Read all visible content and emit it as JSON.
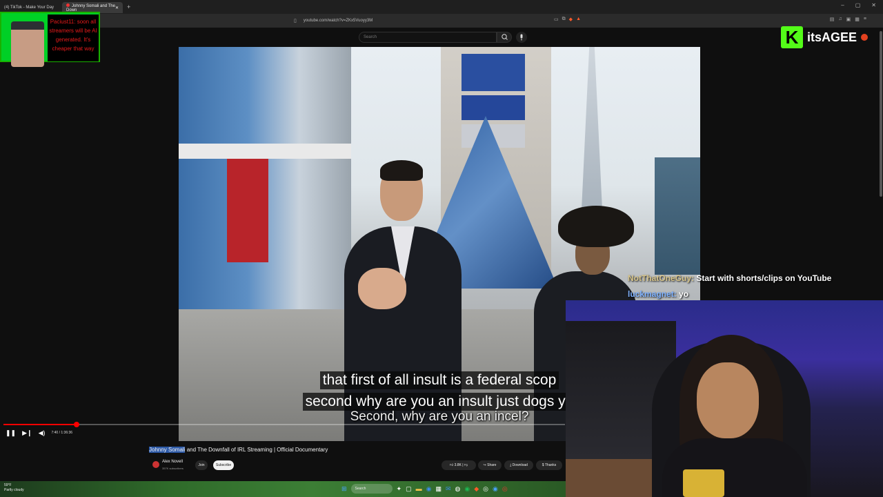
{
  "browser": {
    "tabs": [
      {
        "label": "(4) TikTok - Make Your Day",
        "active": false
      },
      {
        "label": "Johnny Somali and The Down",
        "active": true
      }
    ],
    "new_tab": "+",
    "window_controls": [
      "–",
      "▢",
      "✕"
    ],
    "url": "youtube.com/watch?v=ZKx5Vuoyy3M"
  },
  "youtube": {
    "search_placeholder": "Search",
    "subtitle_line1": "that first of all insult is a federal scop",
    "subtitle_line2": "second why are you an insult just dogs yo",
    "burned_caption": "Second, why are you an incel?",
    "timecode": "7:40 / 1:36:36",
    "progress_fraction": 0.13,
    "title_highlight": "Johnny Somali",
    "title_rest": " and The Downfall of IRL Streaming | Official Documentary",
    "channel_name": "Alex Novell",
    "channel_subs": "357K subscribers",
    "join_label": "Join",
    "subscribe_label": "Subscribe",
    "like_count": "3.8K",
    "share_label": "Share",
    "download_label": "Download",
    "thanks_label": "Thanks"
  },
  "taskbar": {
    "weather_line1": "59°F",
    "weather_line2": "Partly cloudy",
    "search_label": "Search"
  },
  "stream_overlay": {
    "chat_popup": "Paciust11: soon all streamers will be AI generated. It's cheaper that way",
    "brand_name": "itsAGEE",
    "brand_letter": "K",
    "chat": [
      {
        "user": "NotThatOneGuy:",
        "text": " Start with shorts/clips on YouTube"
      },
      {
        "user": "luckmagnet:",
        "text": " yo"
      }
    ]
  },
  "colors": {
    "accent_red": "#ff0000",
    "kick_green": "#53fc18",
    "chat_user_1": "#d6c48a",
    "chat_user_2": "#7fb2ff"
  }
}
